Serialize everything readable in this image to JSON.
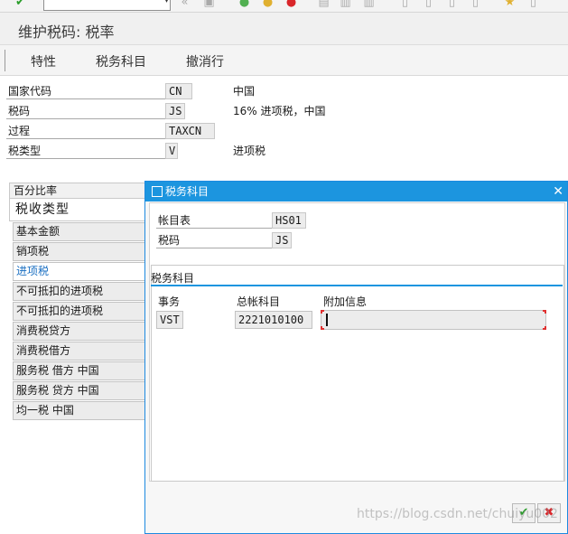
{
  "title": "维护税码: 税率",
  "app_toolbar": [
    "特性",
    "税务科目",
    "撤消行"
  ],
  "header_fields": [
    {
      "label": "国家代码",
      "value": "CN",
      "desc": "中国"
    },
    {
      "label": "税码",
      "value": "JS",
      "desc": "16% 进项税，中国"
    },
    {
      "label": "过程",
      "value": "TAXCN",
      "desc": ""
    },
    {
      "label": "税类型",
      "value": "V",
      "desc": "进项税"
    }
  ],
  "percent_panel": {
    "header": "百分比率",
    "column_header": "税收类型",
    "rows": [
      "基本金额",
      "销项税",
      "进项税",
      "不可抵扣的进项税",
      "不可抵扣的进项税",
      "消费税贷方",
      "消费税借方",
      "服务税 借方 中国",
      "服务税 贷方 中国",
      "均一税 中国"
    ],
    "selected_index": 2
  },
  "dialog": {
    "title": "税务科目",
    "fields": [
      {
        "label": "帐目表",
        "value": "HS01"
      },
      {
        "label": "税码",
        "value": "JS"
      }
    ],
    "group_title": "税务科目",
    "columns": [
      "事务",
      "总帐科目",
      "附加信息"
    ],
    "row": {
      "transaction": "VST",
      "gl_account": "2221010100",
      "extra": ""
    }
  },
  "watermark": "https://blog.csdn.net/chuiyu002",
  "colors": {
    "dialog_title": "#1c95df",
    "selected_row_text": "#1a6fc2",
    "confirm": "#2a9d2a",
    "cancel": "#d9262a"
  }
}
